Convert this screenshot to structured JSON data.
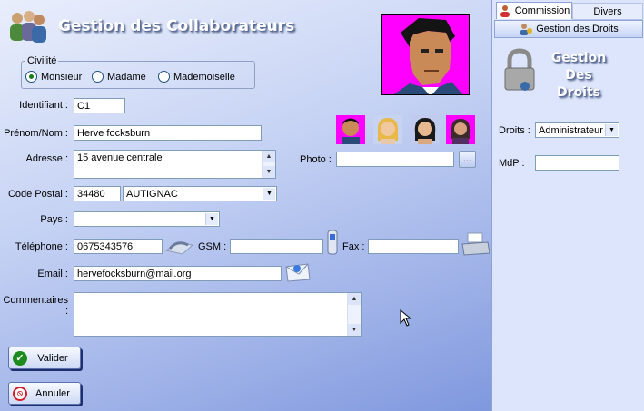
{
  "header": {
    "title": "Gestion des Collaborateurs",
    "icon": "users-icon"
  },
  "civilite": {
    "legend": "Civilité",
    "options": [
      "Monsieur",
      "Madame",
      "Mademoiselle"
    ],
    "selected": "Monsieur"
  },
  "form": {
    "identifiant": {
      "label": "Identifiant :",
      "value": "C1"
    },
    "nom": {
      "label": "Prénom/Nom :",
      "value": "Herve focksburn"
    },
    "adresse": {
      "label": "Adresse :",
      "value": "15 avenue centrale"
    },
    "code_postal": {
      "label": "Code Postal :",
      "value": "34480",
      "ville": "AUTIGNAC"
    },
    "pays": {
      "label": "Pays :",
      "value": ""
    },
    "telephone": {
      "label": "Téléphone :",
      "value": "0675343576"
    },
    "gsm": {
      "label": "GSM :",
      "value": ""
    },
    "fax": {
      "label": "Fax :",
      "value": ""
    },
    "email": {
      "label": "Email :",
      "value": "hervefocksburn@mail.org"
    },
    "commentaires": {
      "label": "Commentaires :",
      "value": ""
    },
    "photo": {
      "label": "Photo :",
      "value": "",
      "browse": "..."
    }
  },
  "buttons": {
    "valider": "Valider",
    "annuler": "Annuler"
  },
  "right_panel": {
    "tabs": [
      "Commission",
      "Divers"
    ],
    "subtab": "Gestion des Droits",
    "title_lines": [
      "Gestion",
      "Des",
      "Droits"
    ],
    "droits": {
      "label": "Droits :",
      "value": "Administrateur"
    },
    "mdp": {
      "label": "MdP :",
      "value": ""
    }
  },
  "colors": {
    "accent": "#ff00ff",
    "panel": "#dce5fb",
    "ok": "#1d8a1d",
    "cancel": "#d0202a"
  }
}
